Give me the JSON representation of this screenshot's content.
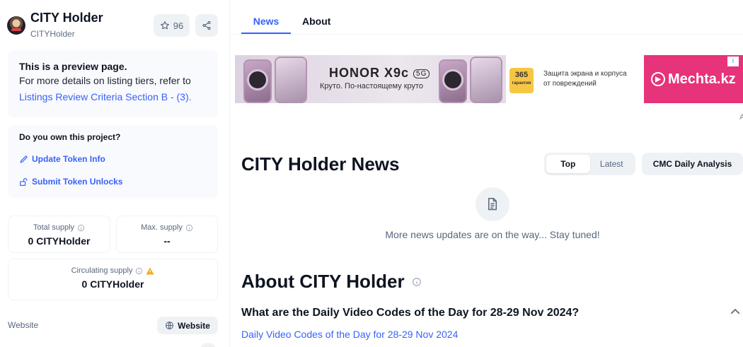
{
  "header": {
    "project_name": "CITY Holder",
    "project_symbol": "CITYHolder",
    "watchlist_count": "96",
    "icons": [
      "avatar",
      "star-icon",
      "share-icon"
    ]
  },
  "preview_notice": {
    "title": "This is a preview page.",
    "text": "For more details on listing tiers, refer to",
    "link": "Listings Review Criteria Section B - (3)."
  },
  "ownership": {
    "title": "Do you own this project?",
    "update_label": "Update Token Info",
    "unlocks_label": "Submit Token Unlocks"
  },
  "stats": {
    "total_supply": {
      "label": "Total supply",
      "value": "0 CITYHolder"
    },
    "max_supply": {
      "label": "Max. supply",
      "value": "--"
    },
    "circulating_supply": {
      "label": "Circulating supply",
      "value": "0 CITYHolder"
    }
  },
  "links": {
    "website_label": "Website",
    "website_button": "Website"
  },
  "tabs": {
    "news": "News",
    "about": "About",
    "active": "News"
  },
  "ads": {
    "brand": "HONOR X9c",
    "badge_5g": "5G",
    "tagline": "Круто. По-настоящему круто",
    "badge_days": "365",
    "badge_caption": "гарантия",
    "promo_line1": "Защита экрана и корпуса",
    "promo_line2": "от повреждений",
    "right_brand": "Mechta.kz",
    "info_mark": "i",
    "corner_mark": "A"
  },
  "news": {
    "title": "CITY Holder News",
    "toggle_top": "Top",
    "toggle_latest": "Latest",
    "toggle_active": "Top",
    "cmc_button": "CMC Daily Analysis",
    "empty_text": "More news updates are on the way... Stay tuned!"
  },
  "about": {
    "title": "About CITY Holder",
    "faq_question": "What are the Daily Video Codes of the Day for 28-29 Nov 2024?",
    "faq_link": "Daily Video Codes of the Day for 28-29 Nov 2024"
  },
  "colors": {
    "accent": "#3861fb",
    "text": "#0d1421",
    "muted": "#58667e",
    "panel": "#f8fafd",
    "chip": "#eff2f5",
    "warning": "#f5a623",
    "ad_pink": "#e6337a"
  }
}
